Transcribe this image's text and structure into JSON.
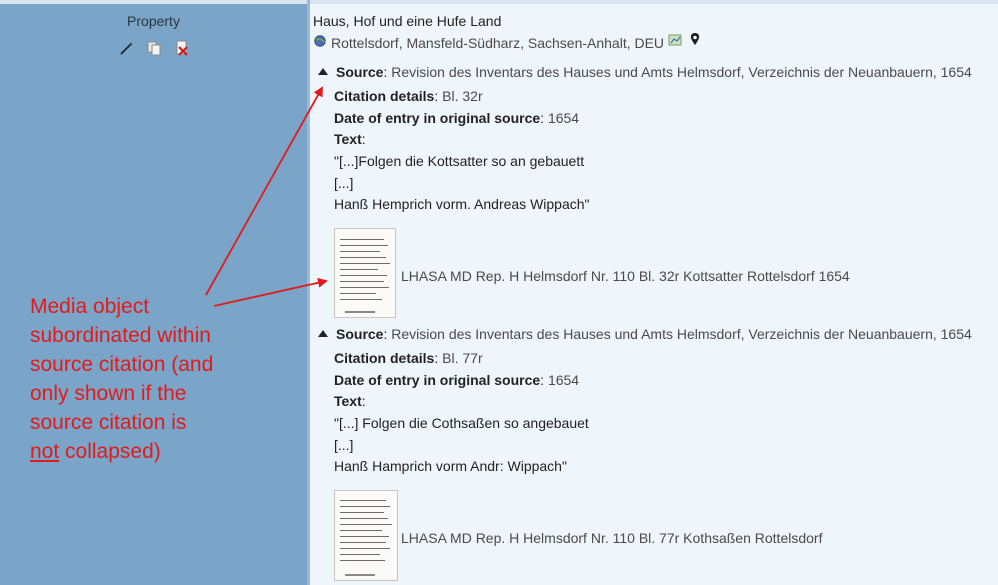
{
  "left": {
    "property_label": "Property",
    "icons": [
      "edit-pencil-icon",
      "copy-icon",
      "delete-icon"
    ]
  },
  "event": {
    "title": "Haus, Hof und eine Hufe Land",
    "place": "Rottelsdorf, Mansfeld-Südharz, Sachsen-Anhalt, DEU",
    "icons": [
      "globe-icon",
      "map-icon",
      "pin-icon"
    ]
  },
  "citations": [
    {
      "source_label": "Source",
      "source_value": "Revision des Inventars des Hauses und Amts Helmsdorf, Verzeichnis der Neuanbauern, 1654",
      "details_label": "Citation details",
      "details_value": "Bl. 32r",
      "date_label": "Date of entry in original source",
      "date_value": "1654",
      "text_label": "Text",
      "text_lines": [
        "\"[...]Folgen die Kottsatter so an gebauett",
        "[...]",
        "Hanß Hemprich vorm. Andreas Wippach\""
      ],
      "media_caption": "LHASA MD Rep. H Helmsdorf Nr. 110 Bl. 32r Kottsatter Rottelsdorf 1654"
    },
    {
      "source_label": "Source",
      "source_value": "Revision des Inventars des Hauses und Amts Helmsdorf, Verzeichnis der Neuanbauern, 1654",
      "details_label": "Citation details",
      "details_value": "Bl. 77r",
      "date_label": "Date of entry in original source",
      "date_value": "1654",
      "text_label": "Text",
      "text_lines": [
        "\"[...] Folgen die Cothsaßen so angebauet",
        "[...]",
        "Hanß Hamprich vorm Andr: Wippach\""
      ],
      "media_caption": "LHASA MD Rep. H Helmsdorf Nr. 110 Bl. 77r Kothsaßen Rottelsdorf"
    }
  ],
  "annotation": {
    "lines": [
      "Media object",
      "subordinated within",
      "source citation (and",
      "only shown if the",
      "source citation is"
    ],
    "last_underlined": "not",
    "last_rest": " collapsed)",
    "color": "#e01b1b"
  }
}
